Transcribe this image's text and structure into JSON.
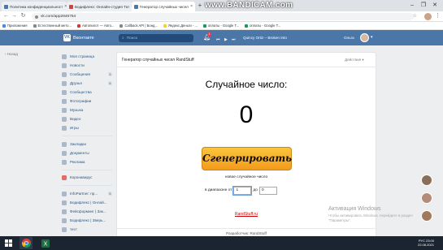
{
  "browser": {
    "tabs": [
      {
        "title": "Политика конфиденциальност",
        "active": false
      },
      {
        "title": "Бодифлекс: Онлайн-студия Тат",
        "active": false
      },
      {
        "title": "Генератор случайных чисел",
        "active": true
      }
    ],
    "new_tab_symbol": "+",
    "watermark": "www.BANDICAM.com",
    "url": "vk.com/app2846764",
    "bookmarks": [
      "Приложения",
      "Естественный мето...",
      "Автопилот — Авто...",
      "Callback API | Бонд...",
      "Яндекс.Деньги - ...",
      "оплаты - Google T...",
      "оплаты - Google T..."
    ]
  },
  "vk_header": {
    "logo": "VK",
    "brand": "Вконтакте",
    "search_placeholder": "Поиск",
    "notification_count": "1",
    "now_playing": "Quincy Ortiz – Broken Into",
    "user_name": "Ольга"
  },
  "sidebar": {
    "back_label": "Назад",
    "groups": [
      [
        {
          "label": "Моя страница",
          "count": ""
        },
        {
          "label": "Новости",
          "count": ""
        },
        {
          "label": "Сообщения",
          "count": "3"
        },
        {
          "label": "Друзья",
          "count": "6"
        },
        {
          "label": "Сообщества",
          "count": ""
        },
        {
          "label": "Фотографии",
          "count": ""
        },
        {
          "label": "Музыка",
          "count": ""
        },
        {
          "label": "Видео",
          "count": ""
        },
        {
          "label": "Игры",
          "count": ""
        }
      ],
      [
        {
          "label": "Закладки",
          "count": ""
        },
        {
          "label": "Документы",
          "count": ""
        },
        {
          "label": "Реклама",
          "count": ""
        }
      ],
      [
        {
          "label": "Коронавирус",
          "count": ""
        }
      ],
      [
        {
          "label": "InfoPartner: пр...",
          "count": "5"
        },
        {
          "label": "Бодифлекс | Онлай...",
          "count": ""
        },
        {
          "label": "Фейсформинг | Зак...",
          "count": ""
        },
        {
          "label": "Бодифлекс | Зверь...",
          "count": ""
        },
        {
          "label": "тест",
          "count": ""
        }
      ]
    ]
  },
  "app": {
    "title": "Генератор случайных чисел RandStuff",
    "actions_label": "Действия",
    "heading": "Случайное число:",
    "number": "0",
    "generate_button": "Сгенерировать",
    "new_number_label": "новое случайное число",
    "range_prefix": "в диапазоне от",
    "range_from": "1",
    "range_to_label": "до",
    "range_to": "0",
    "site_link": "RandStuff.ru",
    "developer": "Разработчик: RandStuff"
  },
  "windows_activation": {
    "title": "Активация Windows",
    "subtitle": "Чтобы активировать Windows, перейдите в раздел \"Параметры\"."
  },
  "taskbar": {
    "language": "РУС",
    "time": "23:00",
    "date": "22.08.2021"
  },
  "colors": {
    "vk_blue": "#4a76a8",
    "button_orange": "#f6a623",
    "link_red": "#cc0000"
  }
}
